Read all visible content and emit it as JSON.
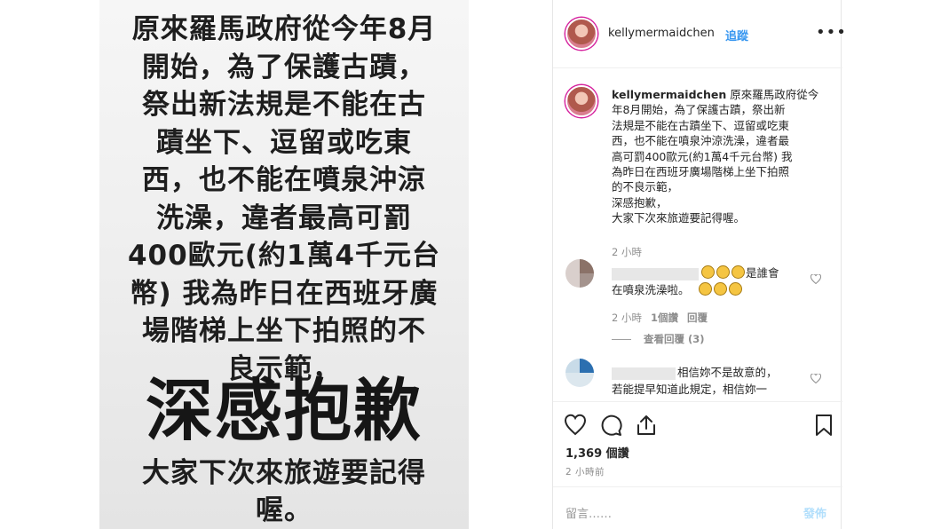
{
  "story": {
    "lines": [
      "原來羅馬政府從今年8月",
      "開始，為了保護古蹟，",
      "祭出新法規是不能在古",
      "蹟坐下、逗留或吃東",
      "西，也不能在噴泉沖涼",
      "洗澡，違者最高可罰",
      "400歐元(約1萬4千元台",
      "幣) 我為昨日在西班牙廣",
      "場階梯上坐下拍照的不",
      "良示範，"
    ],
    "big": "深感抱歉",
    "tail1": "大家下次來旅遊要記得",
    "tail2": "喔。"
  },
  "post": {
    "username": "kellymermaidchen",
    "follow": "追蹤",
    "more": "•••",
    "caption_user": "kellymermaidchen",
    "caption_lines": [
      "原來羅馬政府從今",
      "年8月開始，為了保護古蹟，祭出新",
      "法規是不能在古蹟坐下、逗留或吃東",
      "西，也不能在噴泉沖涼洗澡，違者最",
      "高可罰400歐元(約1萬4千元台幣) 我",
      "為昨日在西班牙廣場階梯上坐下拍照",
      "的不良示範，",
      "深感抱歉，",
      "大家下次來旅遊要記得喔。"
    ],
    "caption_time": "2 小時",
    "comment1": {
      "text_a": "是誰會",
      "text_b": "在噴泉洗澡啦。",
      "time": "2 小時",
      "likes": "1個讚",
      "reply": "回覆",
      "view_replies": "查看回覆 (3)"
    },
    "comment2": {
      "text_a": "相信妳不是故意的，",
      "text_b": "若能提早知道此規定，相信妳一"
    },
    "likes": "1,369 個讚",
    "posted": "2 小時前",
    "add_comment": "留言……",
    "post_button": "發佈"
  }
}
